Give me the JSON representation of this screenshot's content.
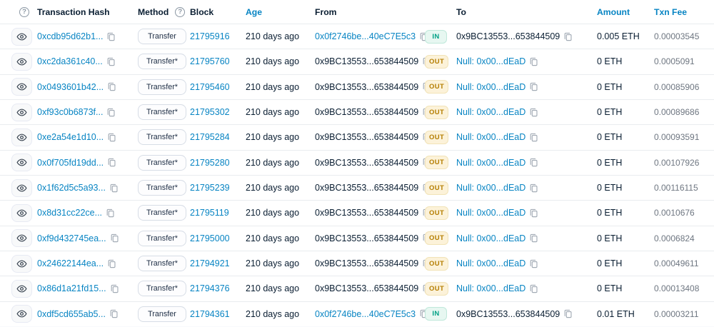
{
  "colors": {
    "link_blue": "#0784c3",
    "in_green": "#00a186",
    "out_amber": "#b47d00",
    "fee_gray": "#6e7681",
    "row_border": "#e9ecef"
  },
  "icons": {
    "help": "question-circle-icon",
    "row_preview": "eye-icon",
    "copy": "copy-icon"
  },
  "header": {
    "help_glyph": "?",
    "method_help_glyph": "?",
    "transaction_hash": "Transaction Hash",
    "method": "Method",
    "block": "Block",
    "age": "Age",
    "from": "From",
    "to": "To",
    "amount": "Amount",
    "txn_fee": "Txn Fee"
  },
  "rows": [
    {
      "hash": "0xcdb95d62b1...",
      "method": "Transfer",
      "block": "21795916",
      "age": "210 days ago",
      "from": "0x0f2746be...40eC7E5c3",
      "from_is_link": true,
      "direction": "IN",
      "to": "0x9BC13553...653844509",
      "to_is_link": false,
      "amount": "0.005 ETH",
      "fee": "0.00003545"
    },
    {
      "hash": "0xc2da361c40...",
      "method": "Transfer*",
      "block": "21795760",
      "age": "210 days ago",
      "from": "0x9BC13553...653844509",
      "from_is_link": false,
      "direction": "OUT",
      "to": "Null: 0x00...dEaD",
      "to_is_link": true,
      "amount": "0 ETH",
      "fee": "0.0005091"
    },
    {
      "hash": "0x0493601b42...",
      "method": "Transfer*",
      "block": "21795460",
      "age": "210 days ago",
      "from": "0x9BC13553...653844509",
      "from_is_link": false,
      "direction": "OUT",
      "to": "Null: 0x00...dEaD",
      "to_is_link": true,
      "amount": "0 ETH",
      "fee": "0.00085906"
    },
    {
      "hash": "0xf93c0b6873f...",
      "method": "Transfer*",
      "block": "21795302",
      "age": "210 days ago",
      "from": "0x9BC13553...653844509",
      "from_is_link": false,
      "direction": "OUT",
      "to": "Null: 0x00...dEaD",
      "to_is_link": true,
      "amount": "0 ETH",
      "fee": "0.00089686"
    },
    {
      "hash": "0xe2a54e1d10...",
      "method": "Transfer*",
      "block": "21795284",
      "age": "210 days ago",
      "from": "0x9BC13553...653844509",
      "from_is_link": false,
      "direction": "OUT",
      "to": "Null: 0x00...dEaD",
      "to_is_link": true,
      "amount": "0 ETH",
      "fee": "0.00093591"
    },
    {
      "hash": "0x0f705fd19dd...",
      "method": "Transfer*",
      "block": "21795280",
      "age": "210 days ago",
      "from": "0x9BC13553...653844509",
      "from_is_link": false,
      "direction": "OUT",
      "to": "Null: 0x00...dEaD",
      "to_is_link": true,
      "amount": "0 ETH",
      "fee": "0.00107926"
    },
    {
      "hash": "0x1f62d5c5a93...",
      "method": "Transfer*",
      "block": "21795239",
      "age": "210 days ago",
      "from": "0x9BC13553...653844509",
      "from_is_link": false,
      "direction": "OUT",
      "to": "Null: 0x00...dEaD",
      "to_is_link": true,
      "amount": "0 ETH",
      "fee": "0.00116115"
    },
    {
      "hash": "0x8d31cc22ce...",
      "method": "Transfer*",
      "block": "21795119",
      "age": "210 days ago",
      "from": "0x9BC13553...653844509",
      "from_is_link": false,
      "direction": "OUT",
      "to": "Null: 0x00...dEaD",
      "to_is_link": true,
      "amount": "0 ETH",
      "fee": "0.0010676"
    },
    {
      "hash": "0xf9d432745ea...",
      "method": "Transfer*",
      "block": "21795000",
      "age": "210 days ago",
      "from": "0x9BC13553...653844509",
      "from_is_link": false,
      "direction": "OUT",
      "to": "Null: 0x00...dEaD",
      "to_is_link": true,
      "amount": "0 ETH",
      "fee": "0.0006824"
    },
    {
      "hash": "0x24622144ea...",
      "method": "Transfer*",
      "block": "21794921",
      "age": "210 days ago",
      "from": "0x9BC13553...653844509",
      "from_is_link": false,
      "direction": "OUT",
      "to": "Null: 0x00...dEaD",
      "to_is_link": true,
      "amount": "0 ETH",
      "fee": "0.00049611"
    },
    {
      "hash": "0x86d1a21fd15...",
      "method": "Transfer*",
      "block": "21794376",
      "age": "210 days ago",
      "from": "0x9BC13553...653844509",
      "from_is_link": false,
      "direction": "OUT",
      "to": "Null: 0x00...dEaD",
      "to_is_link": true,
      "amount": "0 ETH",
      "fee": "0.00013408"
    },
    {
      "hash": "0xdf5cd655ab5...",
      "method": "Transfer",
      "block": "21794361",
      "age": "210 days ago",
      "from": "0x0f2746be...40eC7E5c3",
      "from_is_link": true,
      "direction": "IN",
      "to": "0x9BC13553...653844509",
      "to_is_link": false,
      "amount": "0.01 ETH",
      "fee": "0.00003211"
    }
  ]
}
